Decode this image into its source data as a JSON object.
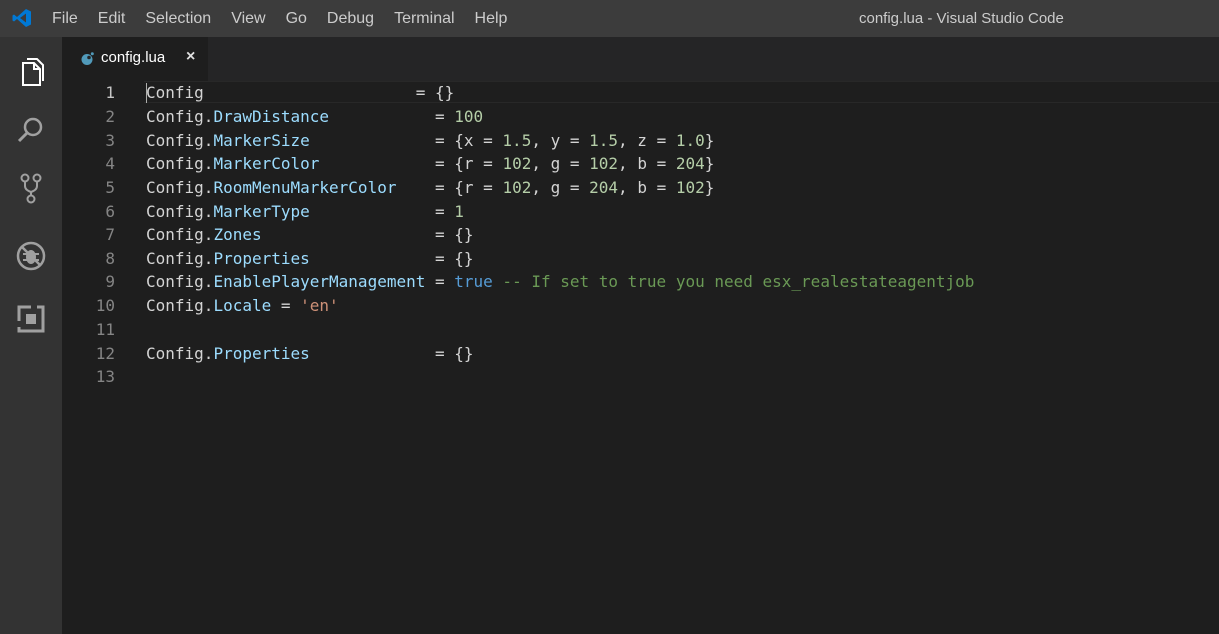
{
  "app": {
    "window_title": "config.lua - Visual Studio Code",
    "logo_icon": "vscode-logo-icon"
  },
  "menu": [
    "File",
    "Edit",
    "Selection",
    "View",
    "Go",
    "Debug",
    "Terminal",
    "Help"
  ],
  "activity_bar": [
    {
      "name": "explorer-icon"
    },
    {
      "name": "search-icon"
    },
    {
      "name": "source-control-icon"
    },
    {
      "name": "debug-icon"
    },
    {
      "name": "extensions-icon"
    }
  ],
  "tabs": [
    {
      "label": "config.lua",
      "icon": "lua-file-icon",
      "close": "×"
    }
  ],
  "editor": {
    "lines": [
      {
        "num": "1",
        "tokens": [
          {
            "t": "Config",
            "c": ""
          },
          {
            "t": "                      = {}",
            "c": ""
          }
        ]
      },
      {
        "num": "2",
        "tokens": [
          {
            "t": "Config.",
            "c": ""
          },
          {
            "t": "DrawDistance",
            "c": "prop"
          },
          {
            "t": "           = ",
            "c": ""
          },
          {
            "t": "100",
            "c": "num"
          }
        ]
      },
      {
        "num": "3",
        "tokens": [
          {
            "t": "Config.",
            "c": ""
          },
          {
            "t": "MarkerSize",
            "c": "prop"
          },
          {
            "t": "             = {x = ",
            "c": ""
          },
          {
            "t": "1.5",
            "c": "num"
          },
          {
            "t": ", y = ",
            "c": ""
          },
          {
            "t": "1.5",
            "c": "num"
          },
          {
            "t": ", z = ",
            "c": ""
          },
          {
            "t": "1.0",
            "c": "num"
          },
          {
            "t": "}",
            "c": ""
          }
        ]
      },
      {
        "num": "4",
        "tokens": [
          {
            "t": "Config.",
            "c": ""
          },
          {
            "t": "MarkerColor",
            "c": "prop"
          },
          {
            "t": "            = {r = ",
            "c": ""
          },
          {
            "t": "102",
            "c": "num"
          },
          {
            "t": ", g = ",
            "c": ""
          },
          {
            "t": "102",
            "c": "num"
          },
          {
            "t": ", b = ",
            "c": ""
          },
          {
            "t": "204",
            "c": "num"
          },
          {
            "t": "}",
            "c": ""
          }
        ]
      },
      {
        "num": "5",
        "tokens": [
          {
            "t": "Config.",
            "c": ""
          },
          {
            "t": "RoomMenuMarkerColor",
            "c": "prop"
          },
          {
            "t": "    = {r = ",
            "c": ""
          },
          {
            "t": "102",
            "c": "num"
          },
          {
            "t": ", g = ",
            "c": ""
          },
          {
            "t": "204",
            "c": "num"
          },
          {
            "t": ", b = ",
            "c": ""
          },
          {
            "t": "102",
            "c": "num"
          },
          {
            "t": "}",
            "c": ""
          }
        ]
      },
      {
        "num": "6",
        "tokens": [
          {
            "t": "Config.",
            "c": ""
          },
          {
            "t": "MarkerType",
            "c": "prop"
          },
          {
            "t": "             = ",
            "c": ""
          },
          {
            "t": "1",
            "c": "num"
          }
        ]
      },
      {
        "num": "7",
        "tokens": [
          {
            "t": "Config.",
            "c": ""
          },
          {
            "t": "Zones",
            "c": "prop"
          },
          {
            "t": "                  = {}",
            "c": ""
          }
        ]
      },
      {
        "num": "8",
        "tokens": [
          {
            "t": "Config.",
            "c": ""
          },
          {
            "t": "Properties",
            "c": "prop"
          },
          {
            "t": "             = {}",
            "c": ""
          }
        ]
      },
      {
        "num": "9",
        "tokens": [
          {
            "t": "Config.",
            "c": ""
          },
          {
            "t": "EnablePlayerManagement",
            "c": "prop"
          },
          {
            "t": " = ",
            "c": ""
          },
          {
            "t": "true",
            "c": "kw"
          },
          {
            "t": " -- If set to true you need esx_realestateagentjob",
            "c": "cmt"
          }
        ]
      },
      {
        "num": "10",
        "tokens": [
          {
            "t": "Config.",
            "c": ""
          },
          {
            "t": "Locale",
            "c": "prop"
          },
          {
            "t": " = ",
            "c": ""
          },
          {
            "t": "'en'",
            "c": "str"
          }
        ]
      },
      {
        "num": "11",
        "tokens": []
      },
      {
        "num": "12",
        "tokens": [
          {
            "t": "Config.",
            "c": ""
          },
          {
            "t": "Properties",
            "c": "prop"
          },
          {
            "t": "             = {}",
            "c": ""
          }
        ]
      },
      {
        "num": "13",
        "tokens": []
      }
    ]
  }
}
